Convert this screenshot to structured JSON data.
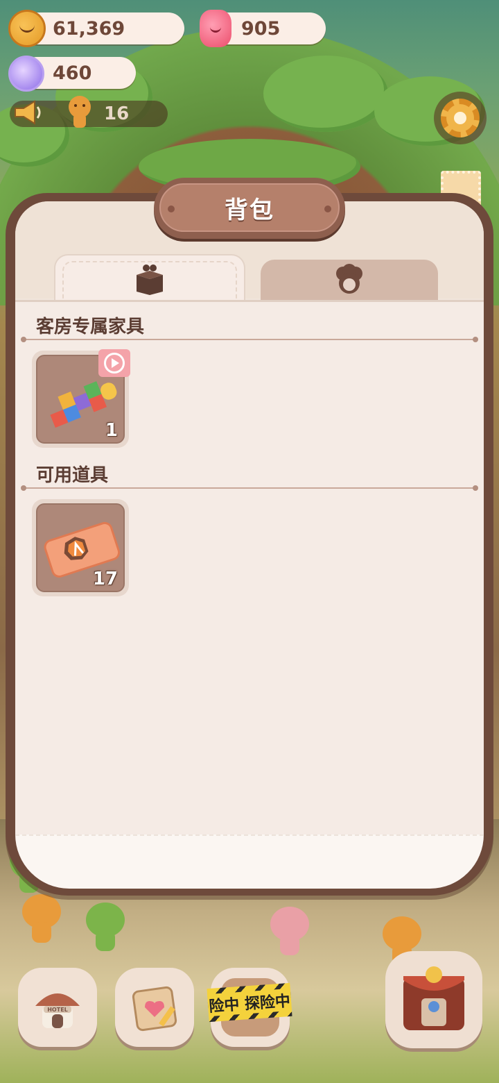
{
  "currencies": {
    "cookies": {
      "value": "61,369",
      "icon": "cookie-icon"
    },
    "candy": {
      "value": "905",
      "icon": "candy-icon"
    },
    "gems": {
      "value": "460",
      "icon": "gem-icon"
    }
  },
  "notice": {
    "count": "16",
    "icon": "megaphone-icon"
  },
  "panel": {
    "title": "背包",
    "tabs": [
      {
        "icon": "box-icon",
        "active": true
      },
      {
        "icon": "character-icon",
        "active": false
      }
    ],
    "sections": [
      {
        "title": "客房专属家具",
        "items": [
          {
            "icon": "hopscotch-icon",
            "count": "1",
            "badge": "video-play-icon"
          }
        ]
      },
      {
        "title": "可用道具",
        "items": [
          {
            "icon": "ticket-icon",
            "count": "17"
          }
        ]
      }
    ]
  },
  "bottom_nav": {
    "buttons": [
      {
        "icon": "hotel-icon",
        "label": "HOTEL"
      },
      {
        "icon": "diary-icon"
      },
      {
        "icon": "adventure-icon",
        "tape_text": "险中 探险中"
      },
      {
        "icon": "circus-stage-icon"
      }
    ]
  },
  "colors": {
    "accent": "#b5806b",
    "panel_border": "#6e4a3b",
    "panel_bg": "#f1e5dc",
    "badge": "#f4a3a9"
  }
}
